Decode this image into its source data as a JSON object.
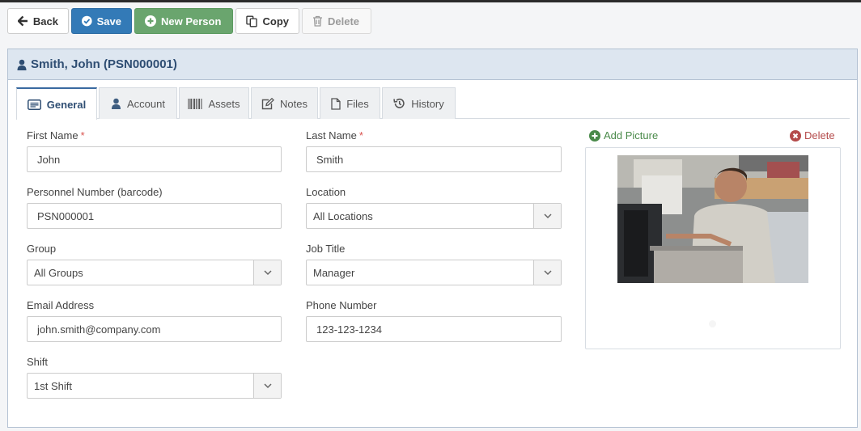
{
  "toolbar": {
    "back": "Back",
    "save": "Save",
    "new_person": "New Person",
    "copy": "Copy",
    "delete": "Delete"
  },
  "header": {
    "title": "Smith, John (PSN000001)"
  },
  "tabs": [
    {
      "label": "General",
      "icon": "id-card-icon",
      "active": true
    },
    {
      "label": "Account",
      "icon": "user-icon"
    },
    {
      "label": "Assets",
      "icon": "barcode-icon"
    },
    {
      "label": "Notes",
      "icon": "edit-icon"
    },
    {
      "label": "Files",
      "icon": "file-icon"
    },
    {
      "label": "History",
      "icon": "history-icon"
    }
  ],
  "form": {
    "first_name": {
      "label": "First Name",
      "required": "*",
      "value": "John"
    },
    "last_name": {
      "label": "Last Name",
      "required": "*",
      "value": "Smith"
    },
    "personnel_number": {
      "label": "Personnel Number (barcode)",
      "value": "PSN000001"
    },
    "location": {
      "label": "Location",
      "value": "All Locations"
    },
    "group": {
      "label": "Group",
      "value": "All Groups"
    },
    "job_title": {
      "label": "Job Title",
      "value": "Manager"
    },
    "email": {
      "label": "Email Address",
      "value": "john.smith@company.com"
    },
    "phone": {
      "label": "Phone Number",
      "value": "123-123-1234"
    },
    "shift": {
      "label": "Shift",
      "value": "1st Shift"
    }
  },
  "picture": {
    "add_label": "Add Picture",
    "delete_label": "Delete"
  },
  "colors": {
    "primary": "#337ab7",
    "success": "#6aa56e",
    "header_bg": "#dde6f0",
    "header_text": "#2f4e73",
    "required": "#d9534f"
  }
}
